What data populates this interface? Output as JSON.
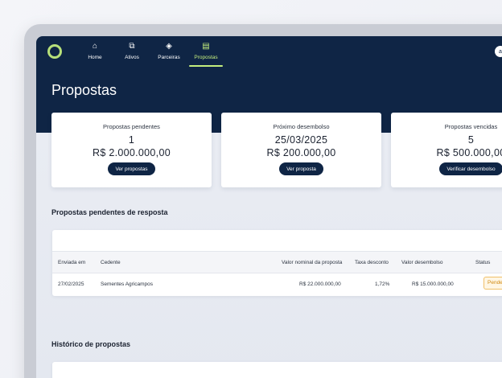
{
  "nav": {
    "items": [
      {
        "label": "Home",
        "icon": "house-icon",
        "glyph": "⌂"
      },
      {
        "label": "Ativos",
        "icon": "layers-icon",
        "glyph": "⧉"
      },
      {
        "label": "Parceiras",
        "icon": "handshake-icon",
        "glyph": "◈"
      },
      {
        "label": "Propostas",
        "icon": "document-icon",
        "glyph": "▤"
      }
    ],
    "active": "Propostas"
  },
  "user": {
    "avatar_text": "a"
  },
  "page": {
    "title": "Propostas"
  },
  "cards": [
    {
      "title": "Propostas pendentes",
      "value1": "1",
      "value2": "R$ 2.000.000,00",
      "button": "Ver propostas"
    },
    {
      "title": "Próximo desembolso",
      "value1": "25/03/2025",
      "value2": "R$ 200.000,00",
      "button": "Ver proposta"
    },
    {
      "title": "Propostas vencidas",
      "value1": "5",
      "value2": "R$ 500.000,00",
      "button": "Verificar desembolso"
    }
  ],
  "pending": {
    "title": "Propostas pendentes de resposta",
    "columns": [
      "Enviada em",
      "Cedente",
      "Valor nominal da proposta",
      "Taxa desconto",
      "Valor desembolso",
      "Status"
    ],
    "rows": [
      {
        "enviada": "27/02/2025",
        "cedente": "Sementes Agricampos",
        "valor_nominal": "R$ 22.000.000,00",
        "taxa": "1,72%",
        "valor_desembolso": "R$ 15.000.000,00",
        "status": "Pendente"
      }
    ]
  },
  "history": {
    "title": "Histórico de propostas"
  },
  "colors": {
    "navy": "#0f2545",
    "accent": "#c4ee7e",
    "pending": "#d08a12"
  }
}
